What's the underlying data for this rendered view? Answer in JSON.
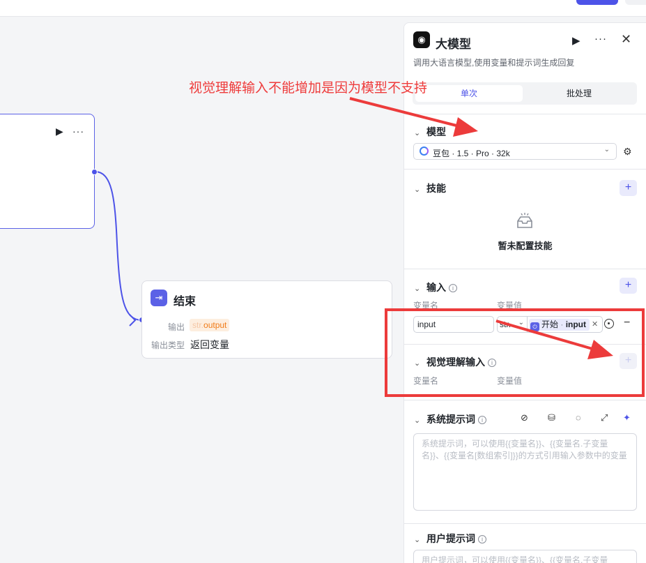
{
  "canvas": {
    "end_node": {
      "title": "结束",
      "output_label": "输出",
      "output_type": "str.",
      "output_var": "output",
      "output_type_label": "输出类型",
      "output_type_value": "返回变量"
    }
  },
  "panel": {
    "title": "大模型",
    "description": "调用大语言模型,使用变量和提示词生成回复",
    "tabs": [
      "单次",
      "批处理"
    ],
    "model_section": {
      "title": "模型",
      "selected_model": "豆包 · 1.5 · Pro · 32k"
    },
    "skills_section": {
      "title": "技能",
      "empty_text": "暂未配置技能"
    },
    "input_section": {
      "title": "输入",
      "col_name": "变量名",
      "col_value": "变量值",
      "row": {
        "name": "input",
        "type": "str.",
        "ref_node": "开始",
        "ref_sep": " · ",
        "ref_var": "input"
      }
    },
    "vision_section": {
      "title": "视觉理解输入",
      "col_name": "变量名",
      "col_value": "变量值"
    },
    "system_prompt": {
      "title": "系统提示词",
      "placeholder": "系统提示词，可以使用{{变量名}}、{{变量名.子变量名}}、{{变量名[数组索引]}}的方式引用输入参数中的变量"
    },
    "user_prompt": {
      "title": "用户提示词",
      "placeholder": "用户提示词，可以使用{{变量名}}、{{变量名.子变量"
    }
  },
  "annotation": {
    "text": "视觉理解输入不能增加是因为模型不支持",
    "color": "#ee3b3b"
  },
  "colors": {
    "accent": "#4d53e8",
    "tag_orange": "#f07b18"
  }
}
